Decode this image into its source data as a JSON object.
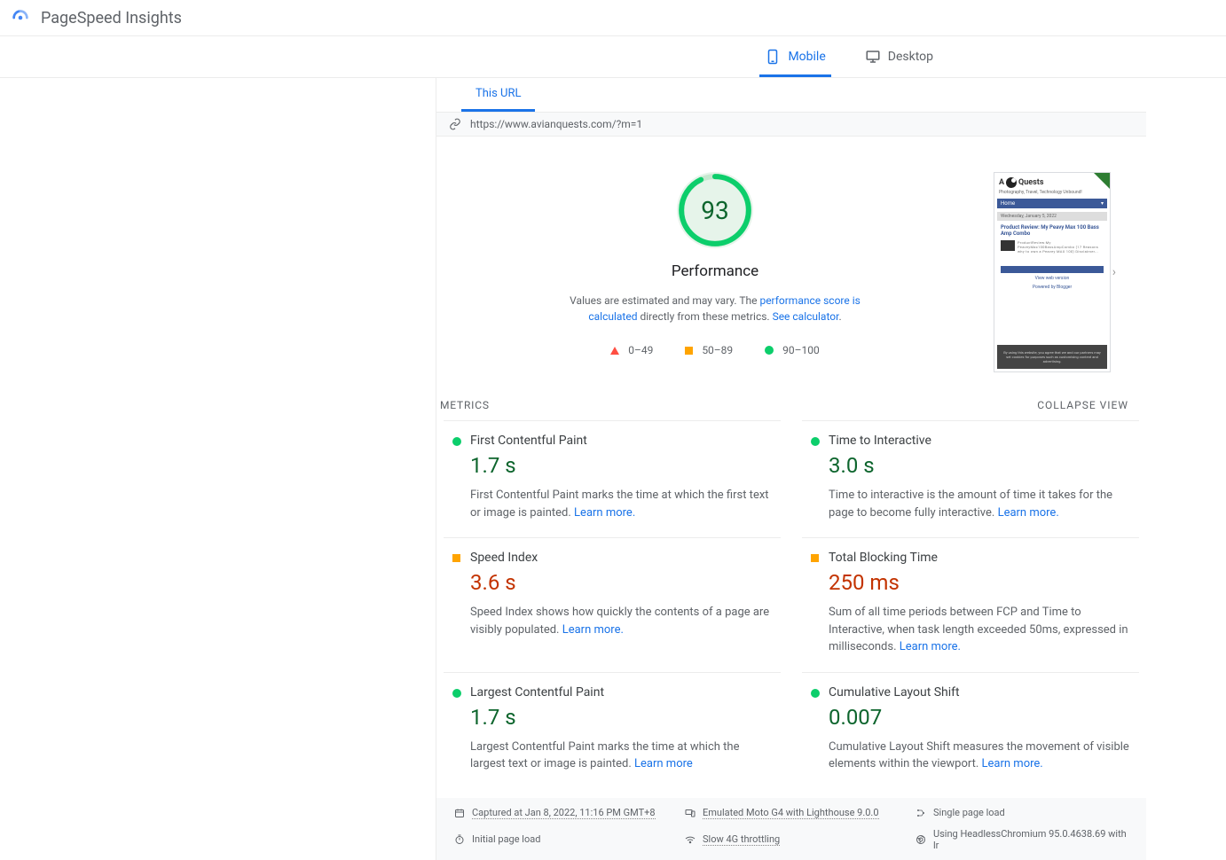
{
  "app": {
    "title": "PageSpeed Insights"
  },
  "tabs": {
    "mobile": "Mobile",
    "desktop": "Desktop"
  },
  "subtab": {
    "this_url": "This URL"
  },
  "url": "https://www.avianquests.com/?m=1",
  "performance": {
    "score": "93",
    "label": "Performance",
    "desc_prefix": "Values are estimated and may vary. The ",
    "desc_link1": "performance score is calculated",
    "desc_mid": " directly from these metrics. ",
    "desc_link2": "See calculator"
  },
  "legend": {
    "poor": "0–49",
    "avg": "50–89",
    "good": "90–100"
  },
  "thumbnail": {
    "brand1": "A",
    "brand2": "Quests",
    "tagline": "Photography, Travel, Technology Unbound!",
    "nav": "Home",
    "date": "Wednesday, January 5, 2022",
    "post_title": "Product Review: My Peavy Max 100 Bass Amp Combo",
    "post_snip": "ProductReview:My PeaveyMax100BassAmpCombo (17 Reasons why to own a Peavey MAX 100)  Disclaimer...",
    "btn": "Home",
    "view": "View web version",
    "powered": "Powered by Blogger",
    "footer": "By using this website, you agree that we and our partners may set cookies for purposes such as customising content and advertising."
  },
  "metrics": {
    "heading": "METRICS",
    "collapse": "Collapse view",
    "learn_more": "Learn more",
    "items": [
      {
        "title": "First Contentful Paint",
        "value": "1.7 s",
        "status": "green",
        "desc": "First Contentful Paint marks the time at which the first text or image is painted. "
      },
      {
        "title": "Time to Interactive",
        "value": "3.0 s",
        "status": "green",
        "desc": "Time to interactive is the amount of time it takes for the page to become fully interactive. "
      },
      {
        "title": "Speed Index",
        "value": "3.6 s",
        "status": "orange",
        "desc": "Speed Index shows how quickly the contents of a page are visibly populated. "
      },
      {
        "title": "Total Blocking Time",
        "value": "250 ms",
        "status": "orange",
        "desc": "Sum of all time periods between FCP and Time to Interactive, when task length exceeded 50ms, expressed in milliseconds. "
      },
      {
        "title": "Largest Contentful Paint",
        "value": "1.7 s",
        "status": "green",
        "desc": "Largest Contentful Paint marks the time at which the largest text or image is painted. "
      },
      {
        "title": "Cumulative Layout Shift",
        "value": "0.007",
        "status": "green",
        "desc": "Cumulative Layout Shift measures the movement of visible elements within the viewport. "
      }
    ]
  },
  "env": {
    "captured": "Captured at Jan 8, 2022, 11:16 PM GMT+8",
    "emulated": "Emulated Moto G4 with Lighthouse 9.0.0",
    "single": "Single page load",
    "initial": "Initial page load",
    "throttle": "Slow 4G throttling",
    "chrome": "Using HeadlessChromium 95.0.4638.69 with lr"
  }
}
